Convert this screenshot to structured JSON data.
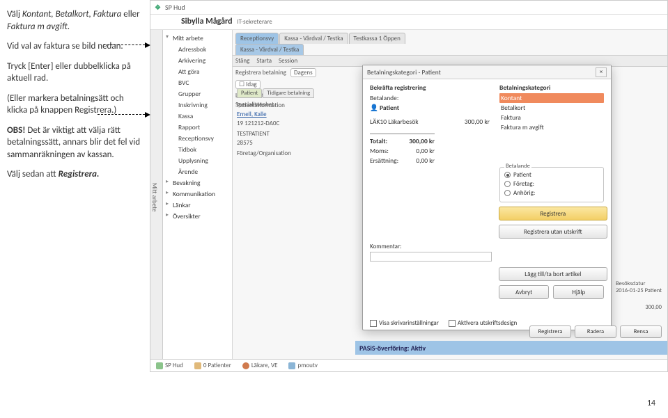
{
  "instructions": {
    "p1a": "Välj ",
    "p1b": "Kontant, Betalkort, Faktura",
    "p1c": " eller ",
    "p1d": "Faktura m avgift",
    "p1e": ".",
    "p2": "Vid val av faktura se bild nedan.",
    "p3": "Tryck [Enter] eller dubbelklicka på aktuell rad.",
    "p4": "(Eller markera betalningsätt och klicka på knappen Registrera.)",
    "p5a": "OBS! ",
    "p5b": "Det är viktigt att välja rätt betalningssätt, annars blir det fel vid sammanräkningen av kassan.",
    "p6a": "Välj sedan att ",
    "p6b": "Registrera."
  },
  "app": {
    "logo": "SP Hud",
    "patient": "Sibylla Mågård",
    "role": "IT-sekreterare",
    "sideStrip": "Mitt arbete",
    "sidebar": [
      {
        "label": "Mitt arbete",
        "parent": true,
        "open": true
      },
      {
        "label": "Adressbok",
        "sub": true
      },
      {
        "label": "Arkivering",
        "sub": true
      },
      {
        "label": "Att göra",
        "sub": true
      },
      {
        "label": "BVC",
        "sub": true
      },
      {
        "label": "Grupper",
        "sub": true
      },
      {
        "label": "Inskrivning",
        "sub": true
      },
      {
        "label": "Kassa",
        "sub": true
      },
      {
        "label": "Rapport",
        "sub": true
      },
      {
        "label": "Receptionsvy",
        "sub": true
      },
      {
        "label": "Tidbok",
        "sub": true
      },
      {
        "label": "Upplysning",
        "sub": true
      },
      {
        "label": "Ärende",
        "sub": true
      },
      {
        "label": "Bevakning",
        "parent": true
      },
      {
        "label": "Kommunikation",
        "parent": true
      },
      {
        "label": "Länkar",
        "parent": true
      },
      {
        "label": "Översikter",
        "parent": true
      }
    ],
    "tabs": {
      "row1": [
        "Receptionsvy",
        "Kassa - Vårdval / Testka",
        "Testkassa 1 Öppen"
      ],
      "row2": [
        "Kassa - Vårdval / Testka"
      ],
      "toolbar": [
        "Stäng",
        "Starta",
        "Session"
      ],
      "regLabel": "Registrera betalning",
      "dagensBtn": "Dagens",
      "idagChip": "Idag",
      "filter1": "Läkarenhet",
      "filter2": "Specialistenhet"
    },
    "leftPanel": {
      "tabs": [
        "Patient",
        "Tidigare betalning"
      ],
      "rows": [
        "Patientinformation",
        "Ernell, Kalle",
        "19 121212-DA0C",
        "",
        "TESTPATIENT",
        "28575",
        "",
        "Företag/Organisation"
      ]
    }
  },
  "dialog": {
    "title": "Betalningskategori - Patient",
    "heading": "Bekräfta registrering",
    "betalLabel": "Betalande:",
    "betalValue": "Patient",
    "item": {
      "label": "LÄK10 Läkarbesök",
      "value": "300,00 kr"
    },
    "totals": [
      {
        "label": "Totalt:",
        "value": "300,00 kr",
        "bold": true
      },
      {
        "label": "Moms:",
        "value": "0,00 kr"
      },
      {
        "label": "Ersättning:",
        "value": "0,00 kr"
      }
    ],
    "katHeading": "Betalningskategori",
    "kategorier": [
      {
        "label": "Kontant",
        "selected": true
      },
      {
        "label": "Betalkort"
      },
      {
        "label": "Faktura"
      },
      {
        "label": "Faktura m avgift"
      }
    ],
    "radioTitle": "Betalande",
    "radios": [
      {
        "label": "Patient",
        "on": true
      },
      {
        "label": "Företag:"
      },
      {
        "label": "Anhörig:"
      }
    ],
    "btnReg": "Registrera",
    "btnRegUtan": "Registrera utan utskrift",
    "kommentar": "Kommentar:",
    "btnAdd": "Lägg till/ta bort artikel",
    "btnAvbryt": "Avbryt",
    "btnHjalp": "Hjälp",
    "cb1": "Visa skrivarinställningar",
    "cb2": "Aktivera utskriftsdesign"
  },
  "workspace": {
    "extra1": "Besöksdatur",
    "extra2": "2016-01-25 Patient",
    "extra3": "300,00",
    "pasis": "PASiS-överföring: Aktiv",
    "footerBtns": [
      "Registrera",
      "Radera",
      "Rensa"
    ]
  },
  "statusbar": {
    "s1": "SP Hud",
    "s2": "0 Patienter",
    "s3": "Läkare, VE",
    "s4": "pmoutv"
  },
  "pageNum": "14"
}
